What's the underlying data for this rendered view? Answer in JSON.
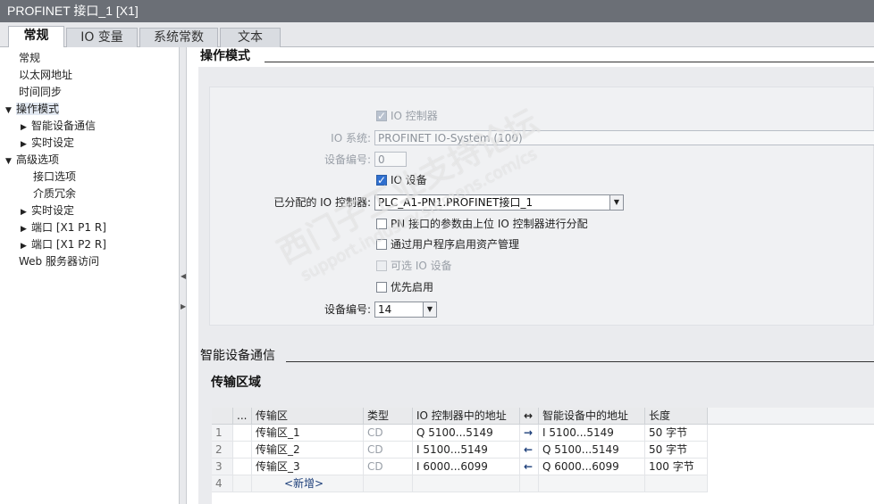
{
  "window": {
    "title": "PROFINET 接口_1 [X1]"
  },
  "tabs": [
    {
      "label": "常规"
    },
    {
      "label": "IO 变量"
    },
    {
      "label": "系统常数"
    },
    {
      "label": "文本"
    }
  ],
  "nav": {
    "items": [
      {
        "label": "常规",
        "tri": ""
      },
      {
        "label": "以太网地址",
        "tri": ""
      },
      {
        "label": "时间同步",
        "tri": ""
      },
      {
        "label": "操作模式",
        "tri": "▼"
      },
      {
        "label": "智能设备通信",
        "tri": "▶"
      },
      {
        "label": "实时设定",
        "tri": "▶"
      },
      {
        "label": "高级选项",
        "tri": "▼"
      },
      {
        "label": "接口选项",
        "tri": ""
      },
      {
        "label": "介质冗余",
        "tri": ""
      },
      {
        "label": "实时设定",
        "tri": "▶"
      },
      {
        "label": "端口 [X1 P1 R]",
        "tri": "▶"
      },
      {
        "label": "端口 [X1 P2 R]",
        "tri": "▶"
      },
      {
        "label": "Web 服务器访问",
        "tri": ""
      }
    ]
  },
  "operation_mode": {
    "heading": "操作模式",
    "io_controller_label": "IO 控制器",
    "io_system_label": "IO 系统:",
    "io_system_value": "PROFINET IO-System (100)",
    "device_number_label": "设备编号:",
    "device_number_value": "0",
    "io_device_label": "IO 设备",
    "assigned_controller_label": "已分配的 IO 控制器:",
    "assigned_controller_value": "PLC_A1-PN1.PROFINET接口_1",
    "pn_params_label": "PN 接口的参数由上位 IO 控制器进行分配",
    "asset_mgmt_label": "通过用户程序启用资产管理",
    "optional_device_label": "可选 IO 设备",
    "priority_startup_label": "优先启用",
    "device_number2_label": "设备编号:",
    "device_number2_value": "14"
  },
  "idevice": {
    "heading": "智能设备通信",
    "transfer_heading": "传输区域",
    "columns": {
      "dots": "...",
      "area": "传输区",
      "type": "类型",
      "ctrl_addr": "IO 控制器中的地址",
      "arrow": "↔",
      "dev_addr": "智能设备中的地址",
      "length": "长度"
    },
    "rows": [
      {
        "num": "1",
        "area": "传输区_1",
        "type": "CD",
        "ctrl_addr": "Q 5100...5149",
        "arrow": "→",
        "dev_addr": "I 5100...5149",
        "length": "50 字节"
      },
      {
        "num": "2",
        "area": "传输区_2",
        "type": "CD",
        "ctrl_addr": "I 5100...5149",
        "arrow": "←",
        "dev_addr": "Q 5100...5149",
        "length": "50 字节"
      },
      {
        "num": "3",
        "area": "传输区_3",
        "type": "CD",
        "ctrl_addr": "I 6000...6099",
        "arrow": "←",
        "dev_addr": "Q 6000...6099",
        "length": "100 字节"
      }
    ],
    "add_row": {
      "num": "4",
      "label": "<新增>"
    }
  },
  "watermark": {
    "line1": "西门子工业支持论坛",
    "line2": "support.industry.siemens.com/cs"
  }
}
